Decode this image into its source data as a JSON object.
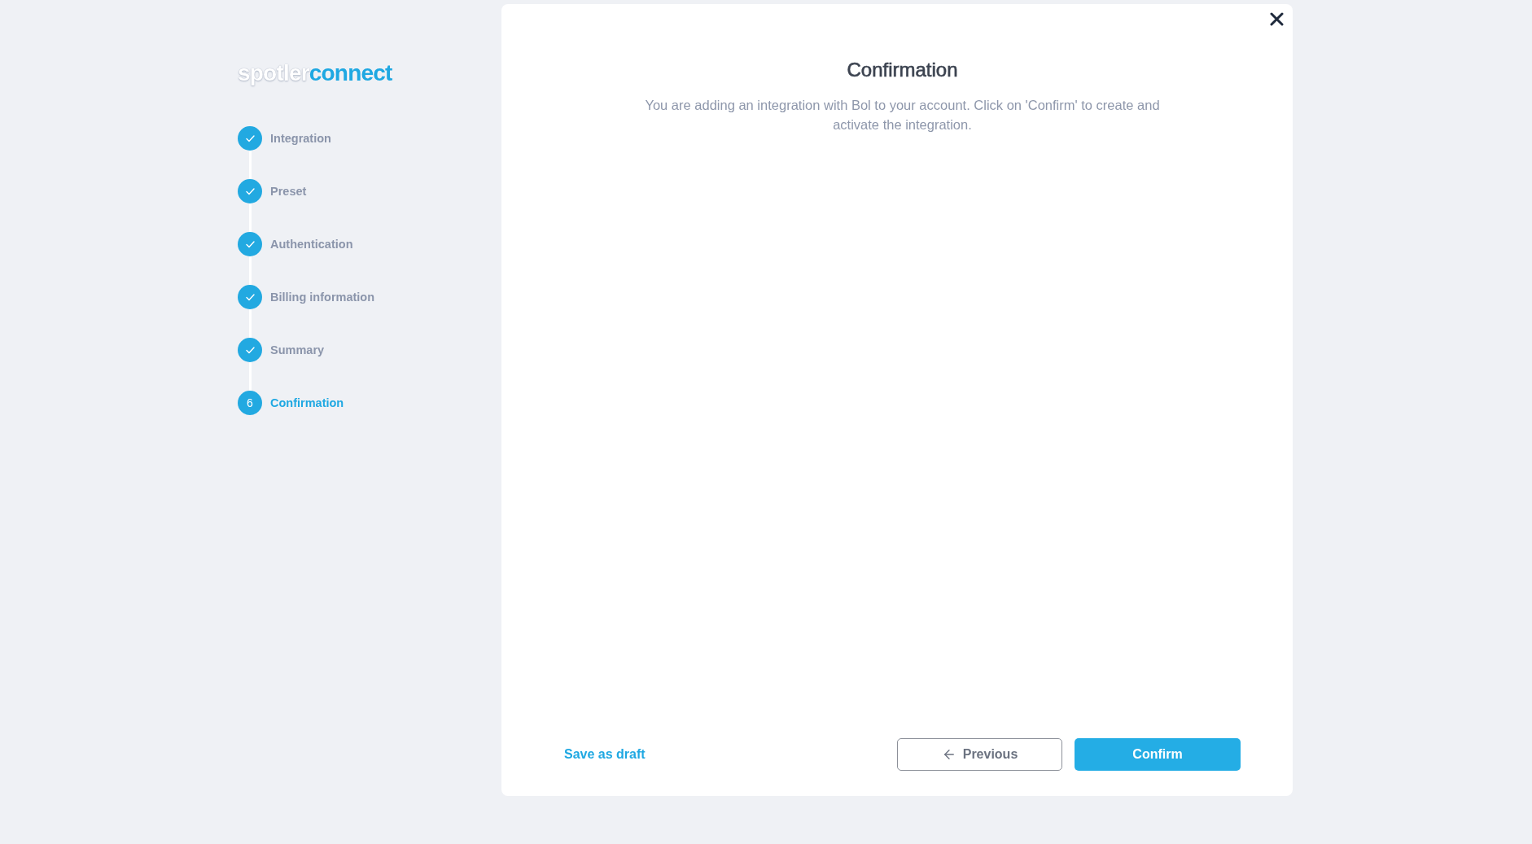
{
  "logo": {
    "words": [
      "spotler",
      "connect"
    ]
  },
  "steps": [
    {
      "label": "Integration",
      "done": true,
      "selected": false
    },
    {
      "label": "Preset",
      "done": true,
      "selected": false
    },
    {
      "label": "Authentication",
      "done": true,
      "selected": false
    },
    {
      "label": "Billing information",
      "done": true,
      "selected": false
    },
    {
      "label": "Summary",
      "done": true,
      "selected": false
    },
    {
      "label": "Confirmation",
      "number": "6",
      "done": false,
      "selected": true
    }
  ],
  "dialog": {
    "title": "Confirmation",
    "description": "You are adding an integration with Bol to your account. Click on 'Confirm' to create and activate the integration.",
    "footer": {
      "save_draft": "Save as draft",
      "previous": "Previous",
      "confirm": "Confirm"
    }
  }
}
